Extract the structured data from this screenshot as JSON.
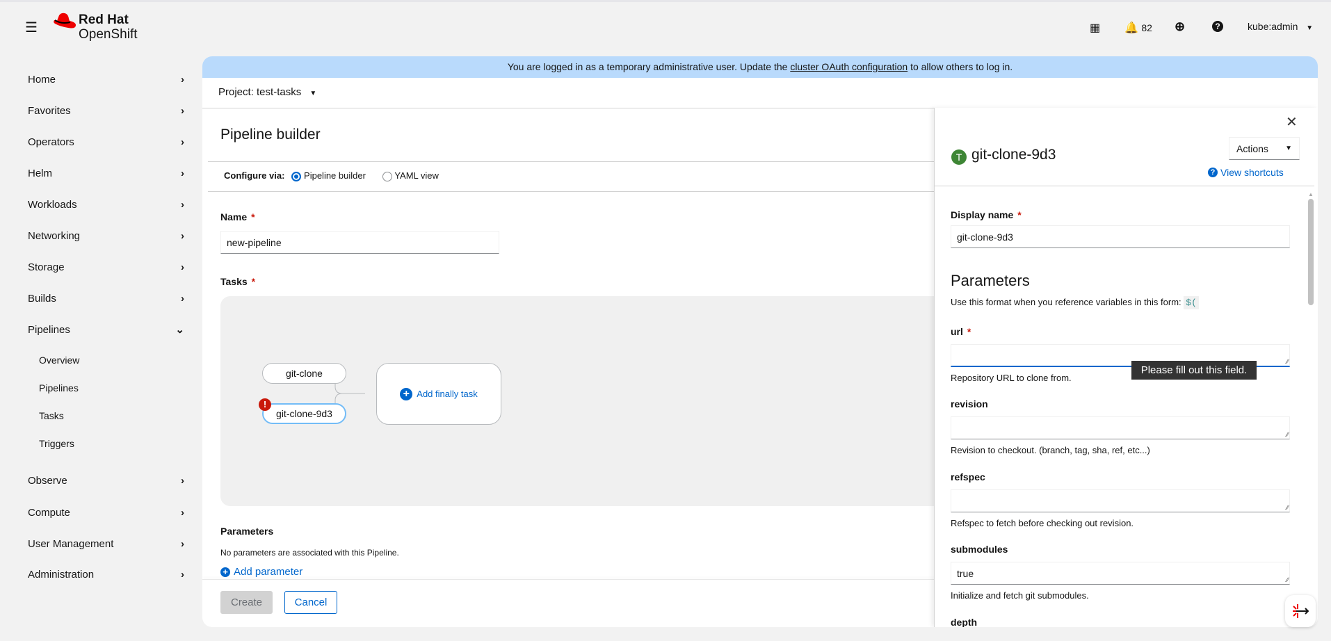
{
  "header": {
    "brand_line1": "Red Hat",
    "brand_line2": "OpenShift",
    "notifications_count": "82",
    "user": "kube:admin"
  },
  "sidebar": {
    "items": [
      {
        "label": "Home"
      },
      {
        "label": "Favorites"
      },
      {
        "label": "Operators"
      },
      {
        "label": "Helm"
      },
      {
        "label": "Workloads"
      },
      {
        "label": "Networking"
      },
      {
        "label": "Storage"
      },
      {
        "label": "Builds"
      },
      {
        "label": "Pipelines",
        "expanded": true
      },
      {
        "label": "Observe"
      },
      {
        "label": "Compute"
      },
      {
        "label": "User Management"
      },
      {
        "label": "Administration"
      }
    ],
    "pipelines_sub": [
      {
        "label": "Overview"
      },
      {
        "label": "Pipelines"
      },
      {
        "label": "Tasks"
      },
      {
        "label": "Triggers"
      }
    ]
  },
  "banner": {
    "text_before": "You are logged in as a temporary administrative user. Update the ",
    "link": "cluster OAuth configuration",
    "text_after": " to allow others to log in."
  },
  "project": {
    "label": "Project: test-tasks"
  },
  "page": {
    "title": "Pipeline builder",
    "configure_via": "Configure via:",
    "options": [
      "Pipeline builder",
      "YAML view"
    ],
    "selected": "Pipeline builder",
    "name_label": "Name",
    "name_value": "new-pipeline",
    "tasks_label": "Tasks",
    "tasks": [
      "git-clone",
      "git-clone-9d3"
    ],
    "add_finally": "Add finally task",
    "params_heading": "Parameters",
    "params_empty": "No parameters are associated with this Pipeline.",
    "add_param": "Add parameter",
    "create": "Create",
    "cancel": "Cancel"
  },
  "drawer": {
    "badge": "T",
    "title": "git-clone-9d3",
    "actions": "Actions",
    "shortcuts": "View shortcuts",
    "display_name_label": "Display name",
    "display_name_value": "git-clone-9d3",
    "params_heading": "Parameters",
    "format_hint": "Use this format when you reference variables in this form:",
    "format_code": "$(",
    "params": [
      {
        "name": "url",
        "required": true,
        "value": "",
        "help": "Repository URL to clone from."
      },
      {
        "name": "revision",
        "value": "",
        "help": "Revision to checkout. (branch, tag, sha, ref, etc...)"
      },
      {
        "name": "refspec",
        "value": "",
        "help": "Refspec to fetch before checking out revision."
      },
      {
        "name": "submodules",
        "value": "true",
        "help": "Initialize and fetch git submodules."
      },
      {
        "name": "depth",
        "value": ""
      }
    ],
    "tooltip": "Please fill out this field."
  },
  "colors": {
    "accent": "#0066cc",
    "banner": "#b9dafc",
    "error": "#c9190b",
    "task_badge": "#3e8635"
  }
}
